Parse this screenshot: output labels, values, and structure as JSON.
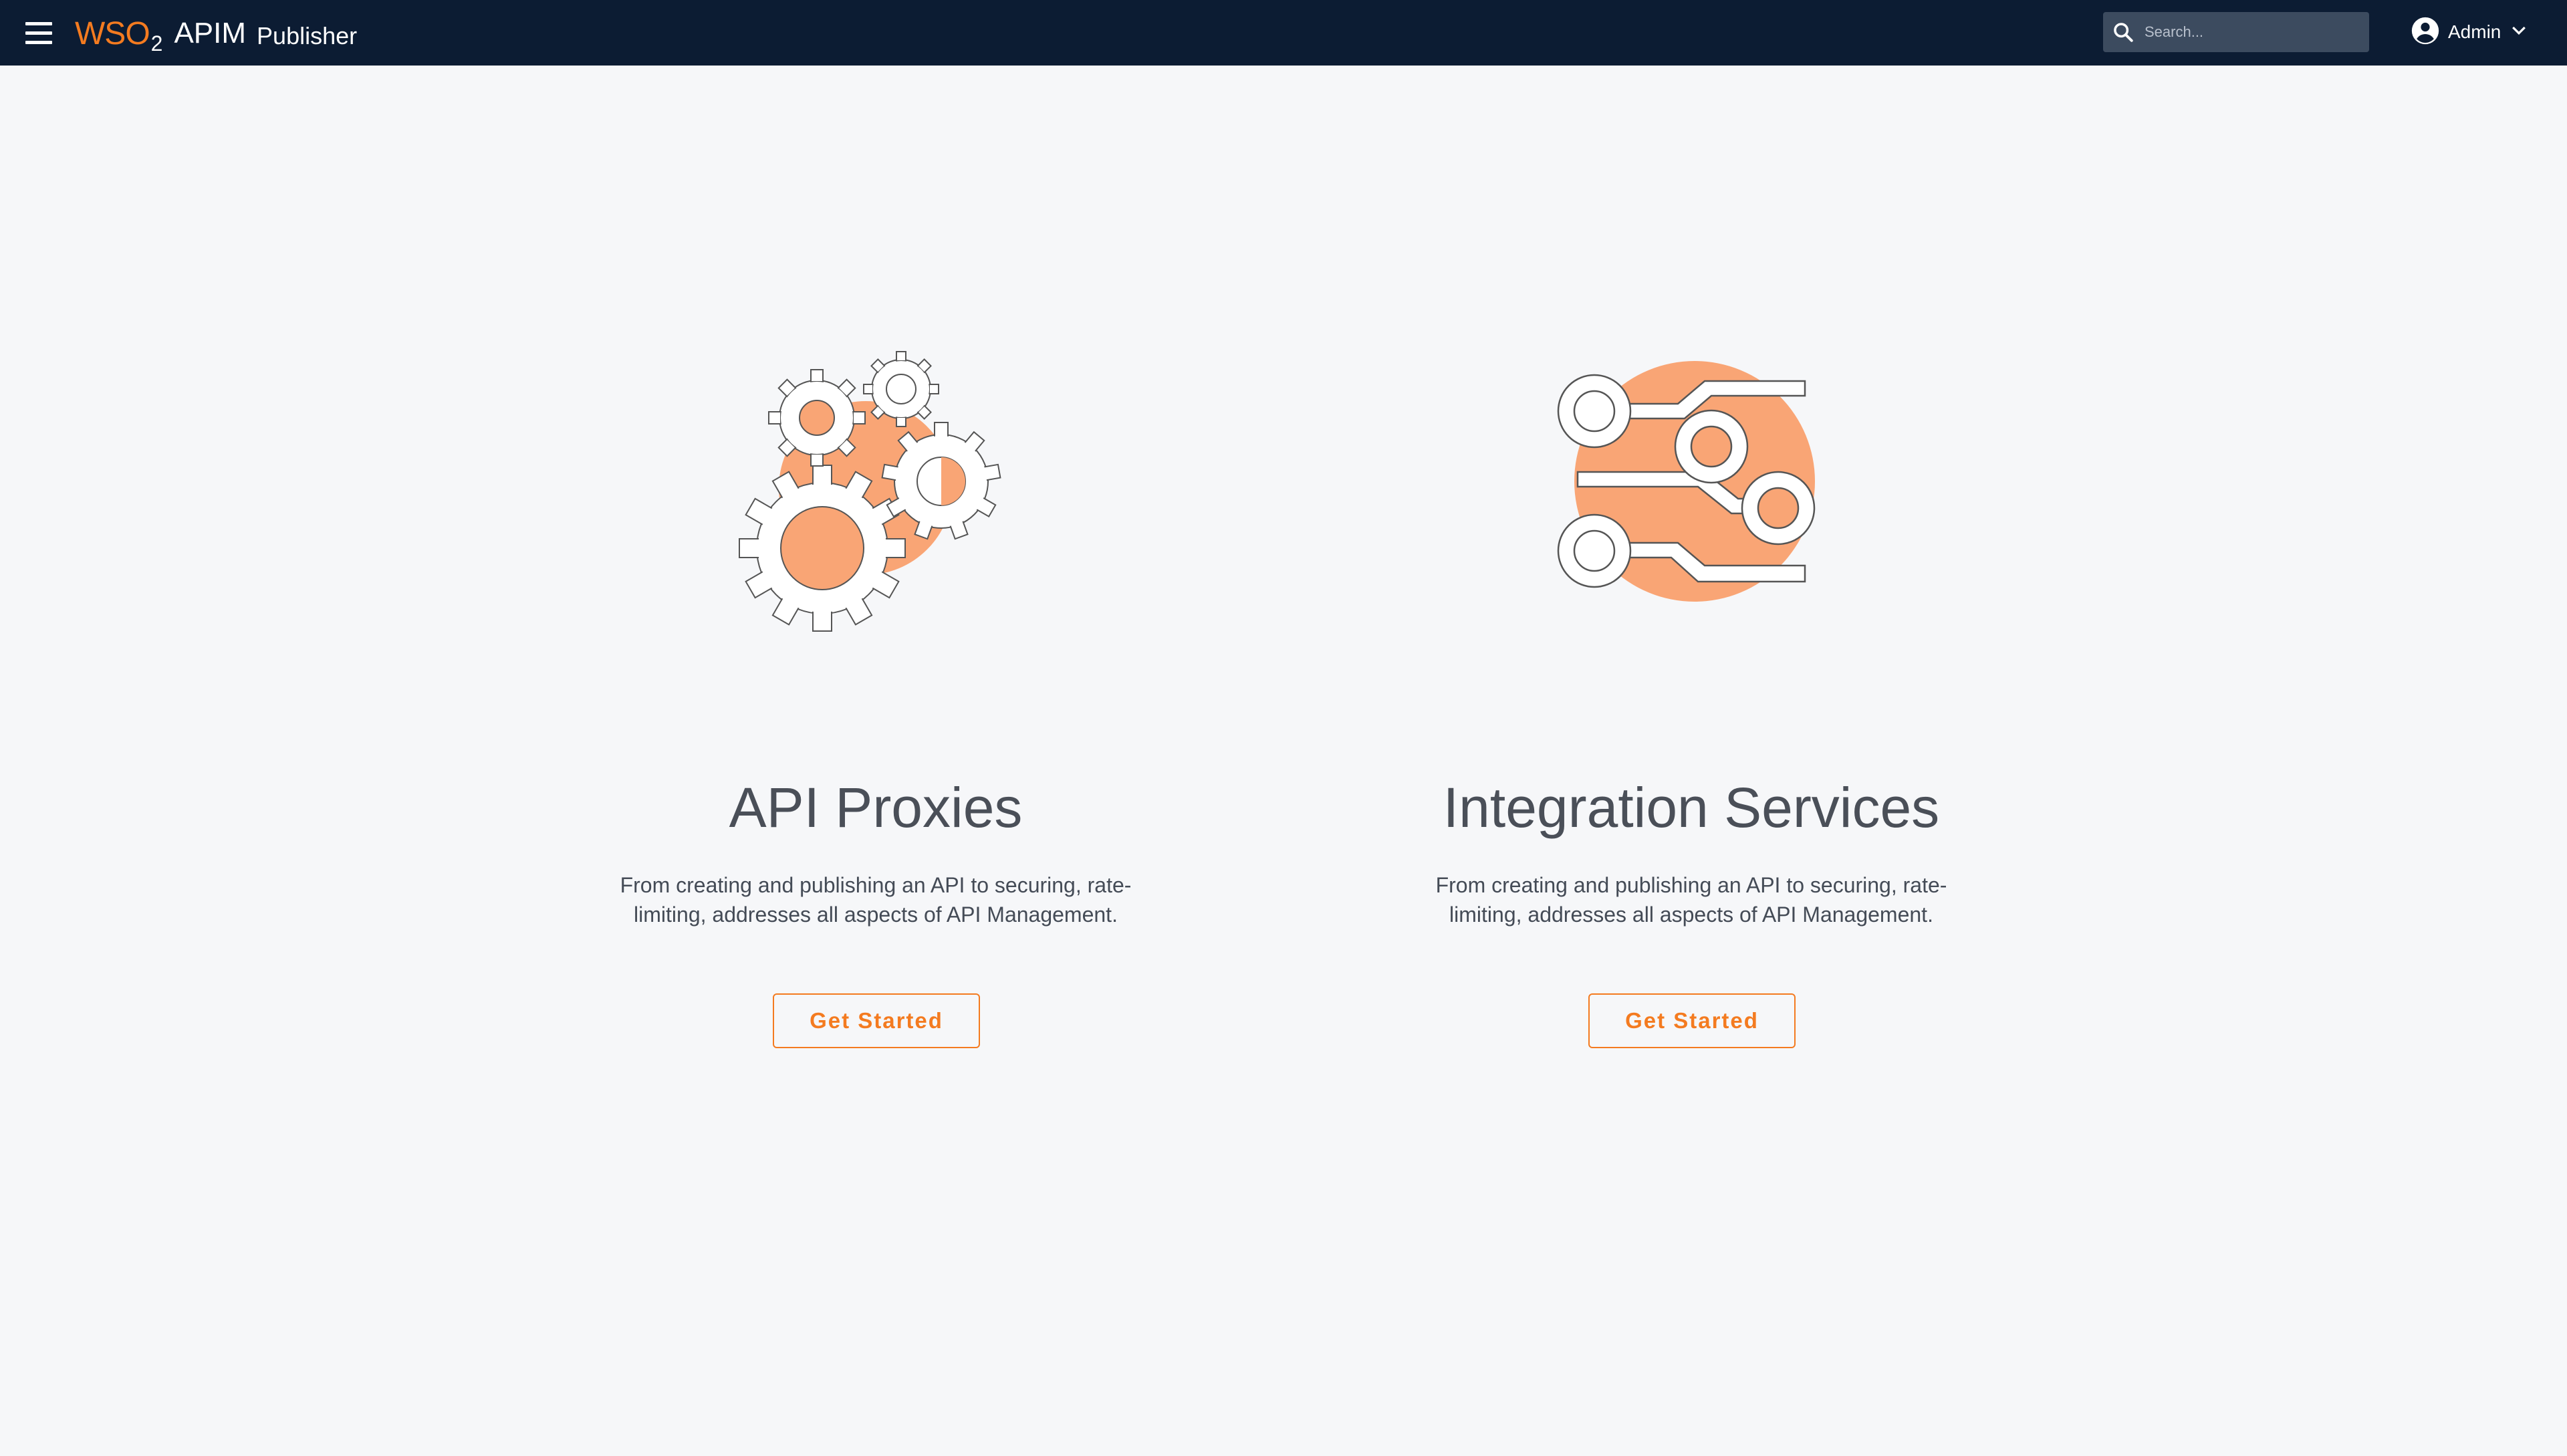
{
  "header": {
    "logo_text": "WSO",
    "logo_sub": "2",
    "product": "APIM",
    "app_name": "Publisher",
    "search_placeholder": "Search...",
    "user_name": "Admin"
  },
  "cards": [
    {
      "title": "API Proxies",
      "description": "From creating and publishing an API to securing, rate-limiting, addresses all aspects of API Management.",
      "button_label": "Get Started",
      "icon": "gears-icon"
    },
    {
      "title": "Integration Services",
      "description": "From creating and publishing an API to securing, rate-limiting, addresses all aspects of API Management.",
      "button_label": "Get Started",
      "icon": "circuit-icon"
    }
  ],
  "colors": {
    "appbar": "#0c1c33",
    "accent": "#f47b20",
    "illustration_fill": "#f9a575",
    "background": "#f6f7f9"
  }
}
